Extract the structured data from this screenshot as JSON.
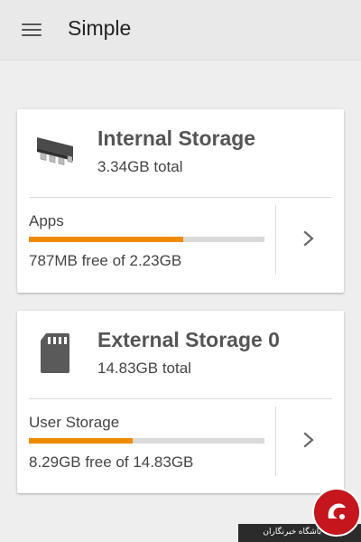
{
  "app": {
    "title": "Simple",
    "menu_icon": "hamburger-menu-icon"
  },
  "cards": [
    {
      "icon": "chip-icon",
      "title": "Internal Storage",
      "total": "3.34GB total",
      "rows": [
        {
          "label": "Apps",
          "free_text": "787MB free of 2.23GB",
          "used_fraction": 0.655,
          "action_icon": "chevron-right-icon"
        }
      ]
    },
    {
      "icon": "sd-card-icon",
      "title": "External Storage 0",
      "total": "14.83GB total",
      "rows": [
        {
          "label": "User Storage",
          "free_text": "8.29GB free of 14.83GB",
          "used_fraction": 0.441,
          "action_icon": "chevron-right-icon"
        }
      ]
    }
  ],
  "watermark": {
    "text": "باشگاه خبرنگاران",
    "logo_icon": "news-agency-logo-icon"
  },
  "colors": {
    "accent": "#f08a00",
    "bar_track": "#dadada",
    "appbar": "#e9e9e9",
    "background": "#eeeeee",
    "watermark_red": "#c4161c"
  }
}
